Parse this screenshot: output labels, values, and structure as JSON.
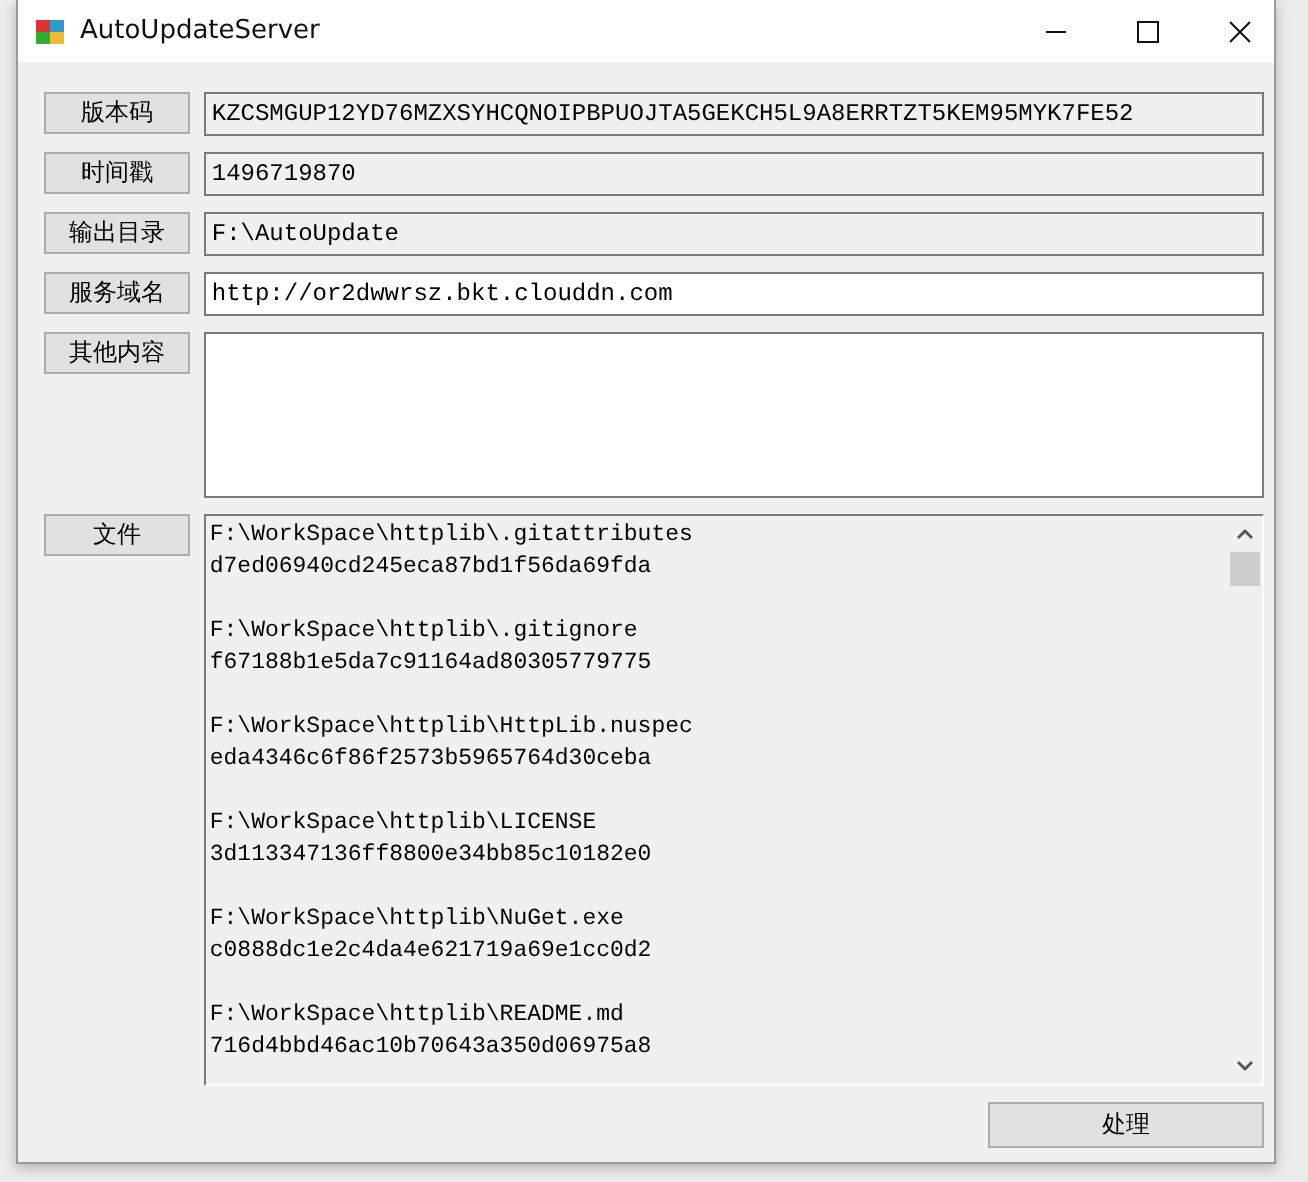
{
  "window": {
    "title": "AutoUpdateServer"
  },
  "fields": [
    {
      "label": "版本码",
      "value": "KZCSMGUP12YD76MZXSYHCQNOIPBPUOJTA5GEKCH5L9A8ERRTZT5KEM95MYK7FE52",
      "readonly": true
    },
    {
      "label": "时间戳",
      "value": "1496719870",
      "readonly": true
    },
    {
      "label": "输出目录",
      "value": "F:\\AutoUpdate",
      "readonly": true
    },
    {
      "label": "服务域名",
      "value": "http://or2dwwrsz.bkt.clouddn.com",
      "readonly": false
    }
  ],
  "other": {
    "label": "其他内容"
  },
  "files": {
    "label": "文件",
    "entries": [
      {
        "path": "F:\\WorkSpace\\httplib\\.gitattributes",
        "hash": "d7ed06940cd245eca87bd1f56da69fda"
      },
      {
        "path": "F:\\WorkSpace\\httplib\\.gitignore",
        "hash": "f67188b1e5da7c91164ad80305779775"
      },
      {
        "path": "F:\\WorkSpace\\httplib\\HttpLib.nuspec",
        "hash": "eda4346c6f86f2573b5965764d30ceba"
      },
      {
        "path": "F:\\WorkSpace\\httplib\\LICENSE",
        "hash": "3d113347136ff8800e34bb85c10182e0"
      },
      {
        "path": "F:\\WorkSpace\\httplib\\NuGet.exe",
        "hash": "c0888dc1e2c4da4e621719a69e1cc0d2"
      },
      {
        "path": "F:\\WorkSpace\\httplib\\README.md",
        "hash": "716d4bbd46ac10b70643a350d06975a8"
      }
    ]
  },
  "process_button": "处理"
}
